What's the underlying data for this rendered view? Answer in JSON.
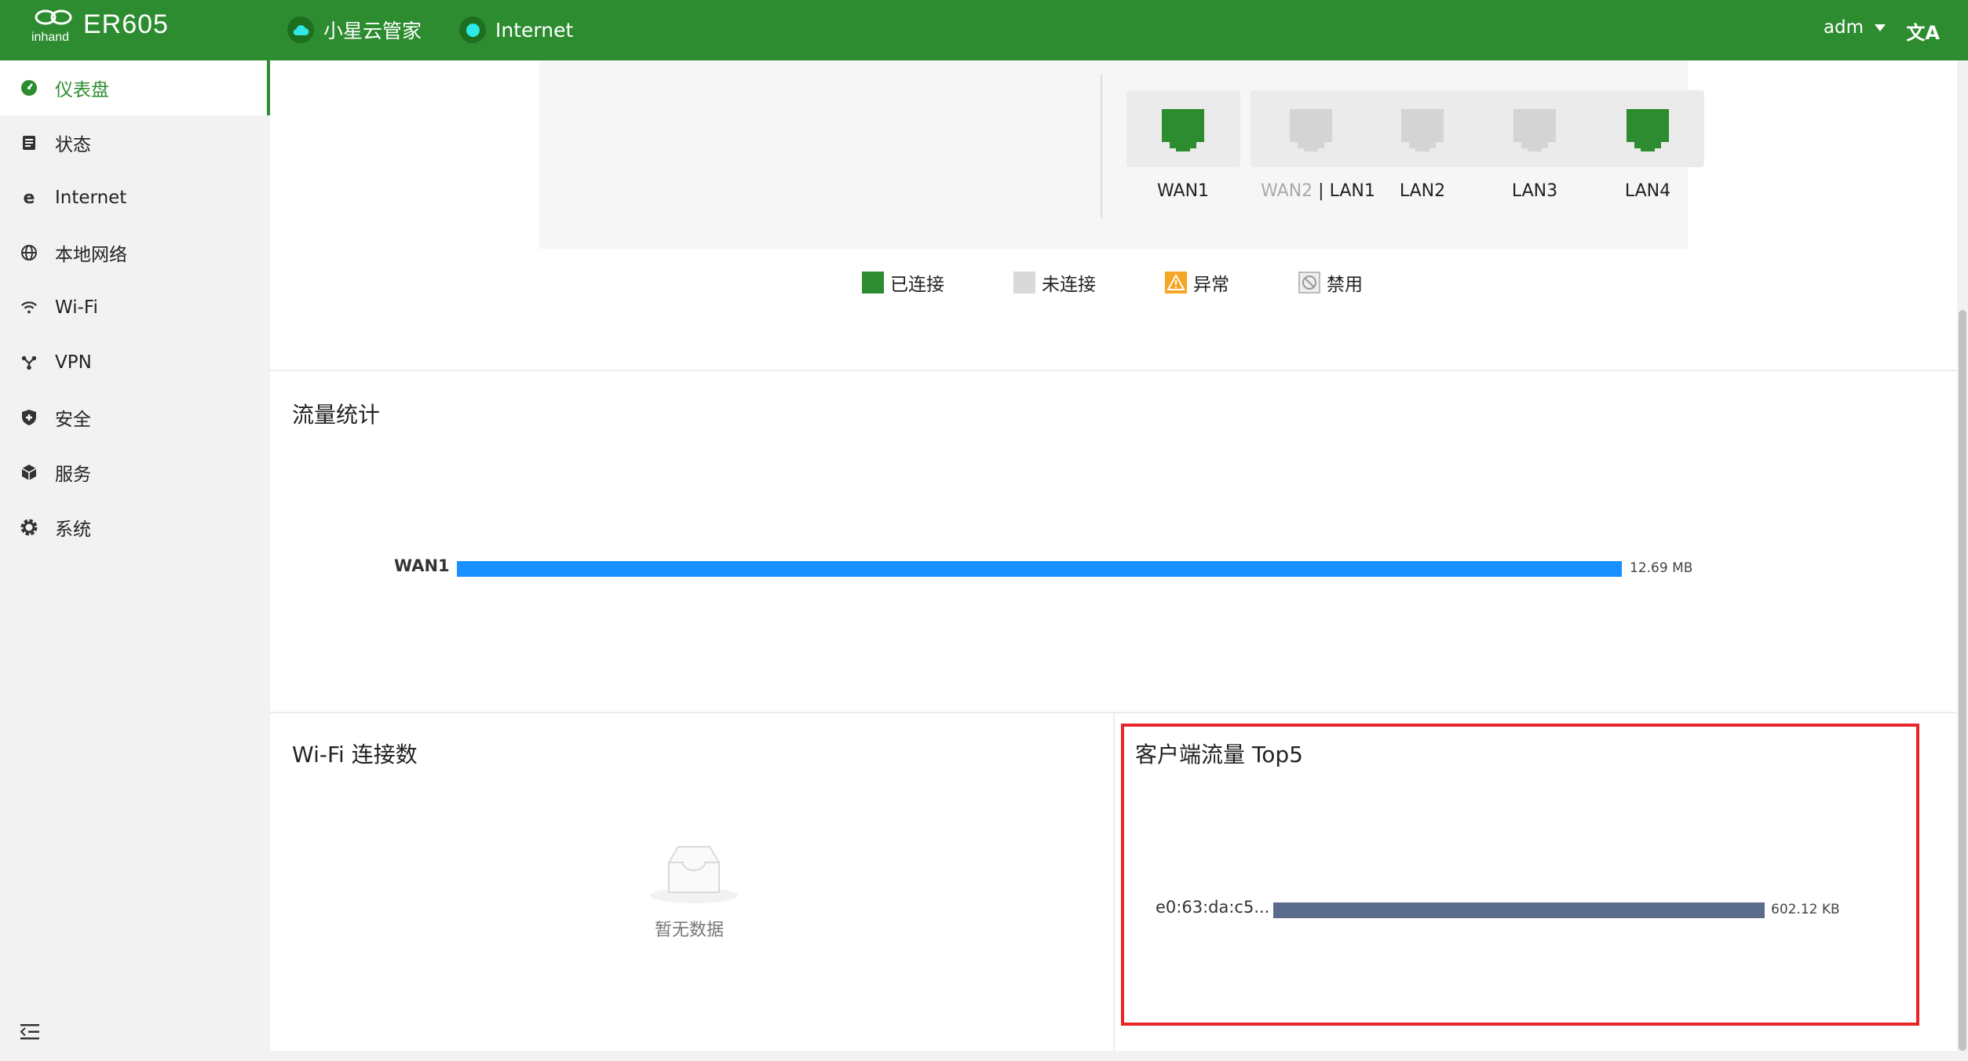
{
  "header": {
    "model": "ER605",
    "cloud_label": "小星云管家",
    "internet_label": "Internet",
    "user": "adm",
    "lang_icon": "translate-icon"
  },
  "sidebar": {
    "items": [
      {
        "label": "仪表盘",
        "icon": "dashboard-icon",
        "active": true
      },
      {
        "label": "状态",
        "icon": "status-icon"
      },
      {
        "label": "Internet",
        "icon": "internet-icon"
      },
      {
        "label": "本地网络",
        "icon": "globe-icon"
      },
      {
        "label": "Wi-Fi",
        "icon": "wifi-icon"
      },
      {
        "label": "VPN",
        "icon": "vpn-icon"
      },
      {
        "label": "安全",
        "icon": "shield-icon"
      },
      {
        "label": "服务",
        "icon": "cube-icon"
      },
      {
        "label": "系统",
        "icon": "gear-icon"
      }
    ]
  },
  "ports": {
    "items": [
      {
        "label": "WAN1",
        "state": "connected"
      },
      {
        "label_a": "WAN2",
        "label_sep": " | ",
        "label_b": "LAN1",
        "state": "disconnected"
      },
      {
        "label": "LAN2",
        "state": "disconnected"
      },
      {
        "label": "LAN3",
        "state": "disconnected"
      },
      {
        "label": "LAN4",
        "state": "connected"
      }
    ],
    "legend": {
      "connected": "已连接",
      "disconnected": "未连接",
      "abnormal": "异常",
      "disabled": "禁用"
    }
  },
  "traffic": {
    "title": "流量统计",
    "label": "WAN1",
    "value": "12.69 MB"
  },
  "wifi": {
    "title": "Wi-Fi 连接数",
    "empty": "暂无数据"
  },
  "top_clients": {
    "title": "客户端流量 Top5",
    "label": "e0:63:da:c5...",
    "value": "602.12 KB"
  },
  "colors": {
    "brand": "#2d8c2f",
    "traffic_bar": "#1890ff",
    "client_bar": "#5b6b8c",
    "highlight": "#e8252a"
  }
}
